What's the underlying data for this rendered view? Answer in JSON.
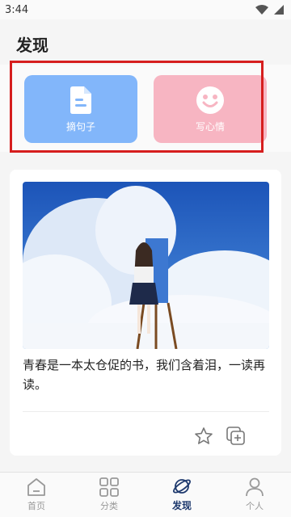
{
  "status_bar": {
    "time": "3:44"
  },
  "header": {
    "title": "发现"
  },
  "quick_actions": [
    {
      "label": "摘句子",
      "icon": "document-icon",
      "color": "#82b6fa"
    },
    {
      "label": "写心情",
      "icon": "smiley-icon",
      "color": "#f7b5c2"
    }
  ],
  "feed": {
    "image": "girl-painting-clouds-illustration",
    "text": "青春是一本太仓促的书，我们含着泪，一读再读。",
    "actions": [
      "star-icon",
      "add-square-icon"
    ]
  },
  "tabs": [
    {
      "label": "首页",
      "icon": "home-icon",
      "active": false
    },
    {
      "label": "分类",
      "icon": "grid-icon",
      "active": false
    },
    {
      "label": "发现",
      "icon": "planet-icon",
      "active": true
    },
    {
      "label": "个人",
      "icon": "person-icon",
      "active": false
    }
  ]
}
